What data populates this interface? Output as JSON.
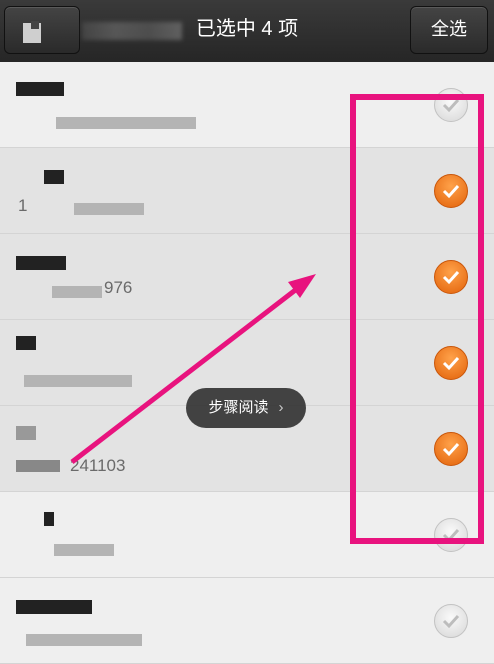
{
  "header": {
    "title": "已选中 4 项",
    "select_all_label": "全选"
  },
  "list": {
    "rows": [
      {
        "checked": false
      },
      {
        "checked": true,
        "partial_text": "1"
      },
      {
        "checked": true,
        "partial_text": "976"
      },
      {
        "checked": true
      },
      {
        "checked": true,
        "partial_text": "241103"
      },
      {
        "checked": false
      },
      {
        "checked": false
      }
    ]
  },
  "floating_button": {
    "label": "步骤阅读",
    "chevron": "›"
  },
  "annotation": {
    "highlight_color": "#e8137e",
    "checked_color": "#f07a1a"
  },
  "icons": {
    "check_icon": "checkmark-icon"
  }
}
